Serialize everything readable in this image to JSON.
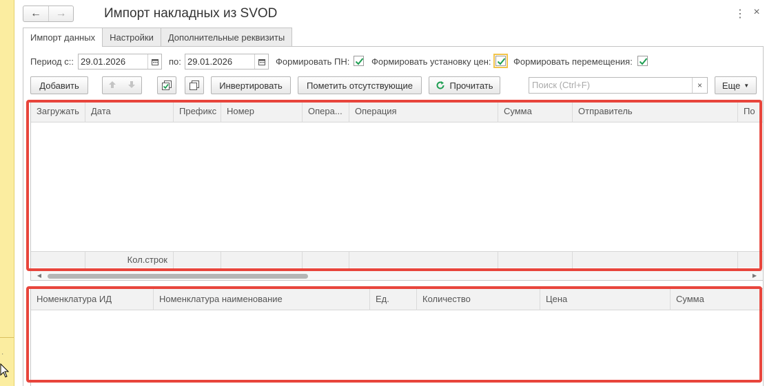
{
  "window": {
    "title": "Импорт накладных из SVOD",
    "back_icon": "←",
    "forward_icon": "→",
    "menu_icon": "⋮",
    "close_icon": "×"
  },
  "tabs": [
    {
      "label": "Импорт данных",
      "active": true
    },
    {
      "label": "Настройки",
      "active": false
    },
    {
      "label": "Дополнительные реквизиты",
      "active": false
    }
  ],
  "filters": {
    "period_from_label": "Период с::",
    "period_from_value": "29.01.2026",
    "period_to_label": "по:",
    "period_to_value": "29.01.2026",
    "form_pn_label": "Формировать ПН:",
    "form_pn_checked": true,
    "form_prices_label": "Формировать установку цен:",
    "form_prices_checked": true,
    "form_moves_label": "Формировать перемещения:",
    "form_moves_checked": true
  },
  "toolbar": {
    "add_label": "Добавить",
    "invert_label": "Инвертировать",
    "mark_missing_label": "Пометить отсутствующие",
    "read_label": "Прочитать",
    "search_placeholder": "Поиск (Ctrl+F)",
    "search_clear": "×",
    "more_label": "Еще"
  },
  "invoices_table": {
    "columns": [
      "Загружать",
      "Дата",
      "Префикс",
      "Номер",
      "Опера...",
      "Операция",
      "Сумма",
      "Отправитель",
      "По"
    ],
    "footer": {
      "count_label": "Кол.строк"
    },
    "scroll_position": 0.0
  },
  "items_table": {
    "columns": [
      "Номенклатура ИД",
      "Номенклатура наименование",
      "Ед.",
      "Количество",
      "Цена",
      "Сумма"
    ]
  },
  "colors": {
    "highlight": "#e8453c",
    "check": "#1e9e52",
    "left_strip": "#fbeda0"
  }
}
